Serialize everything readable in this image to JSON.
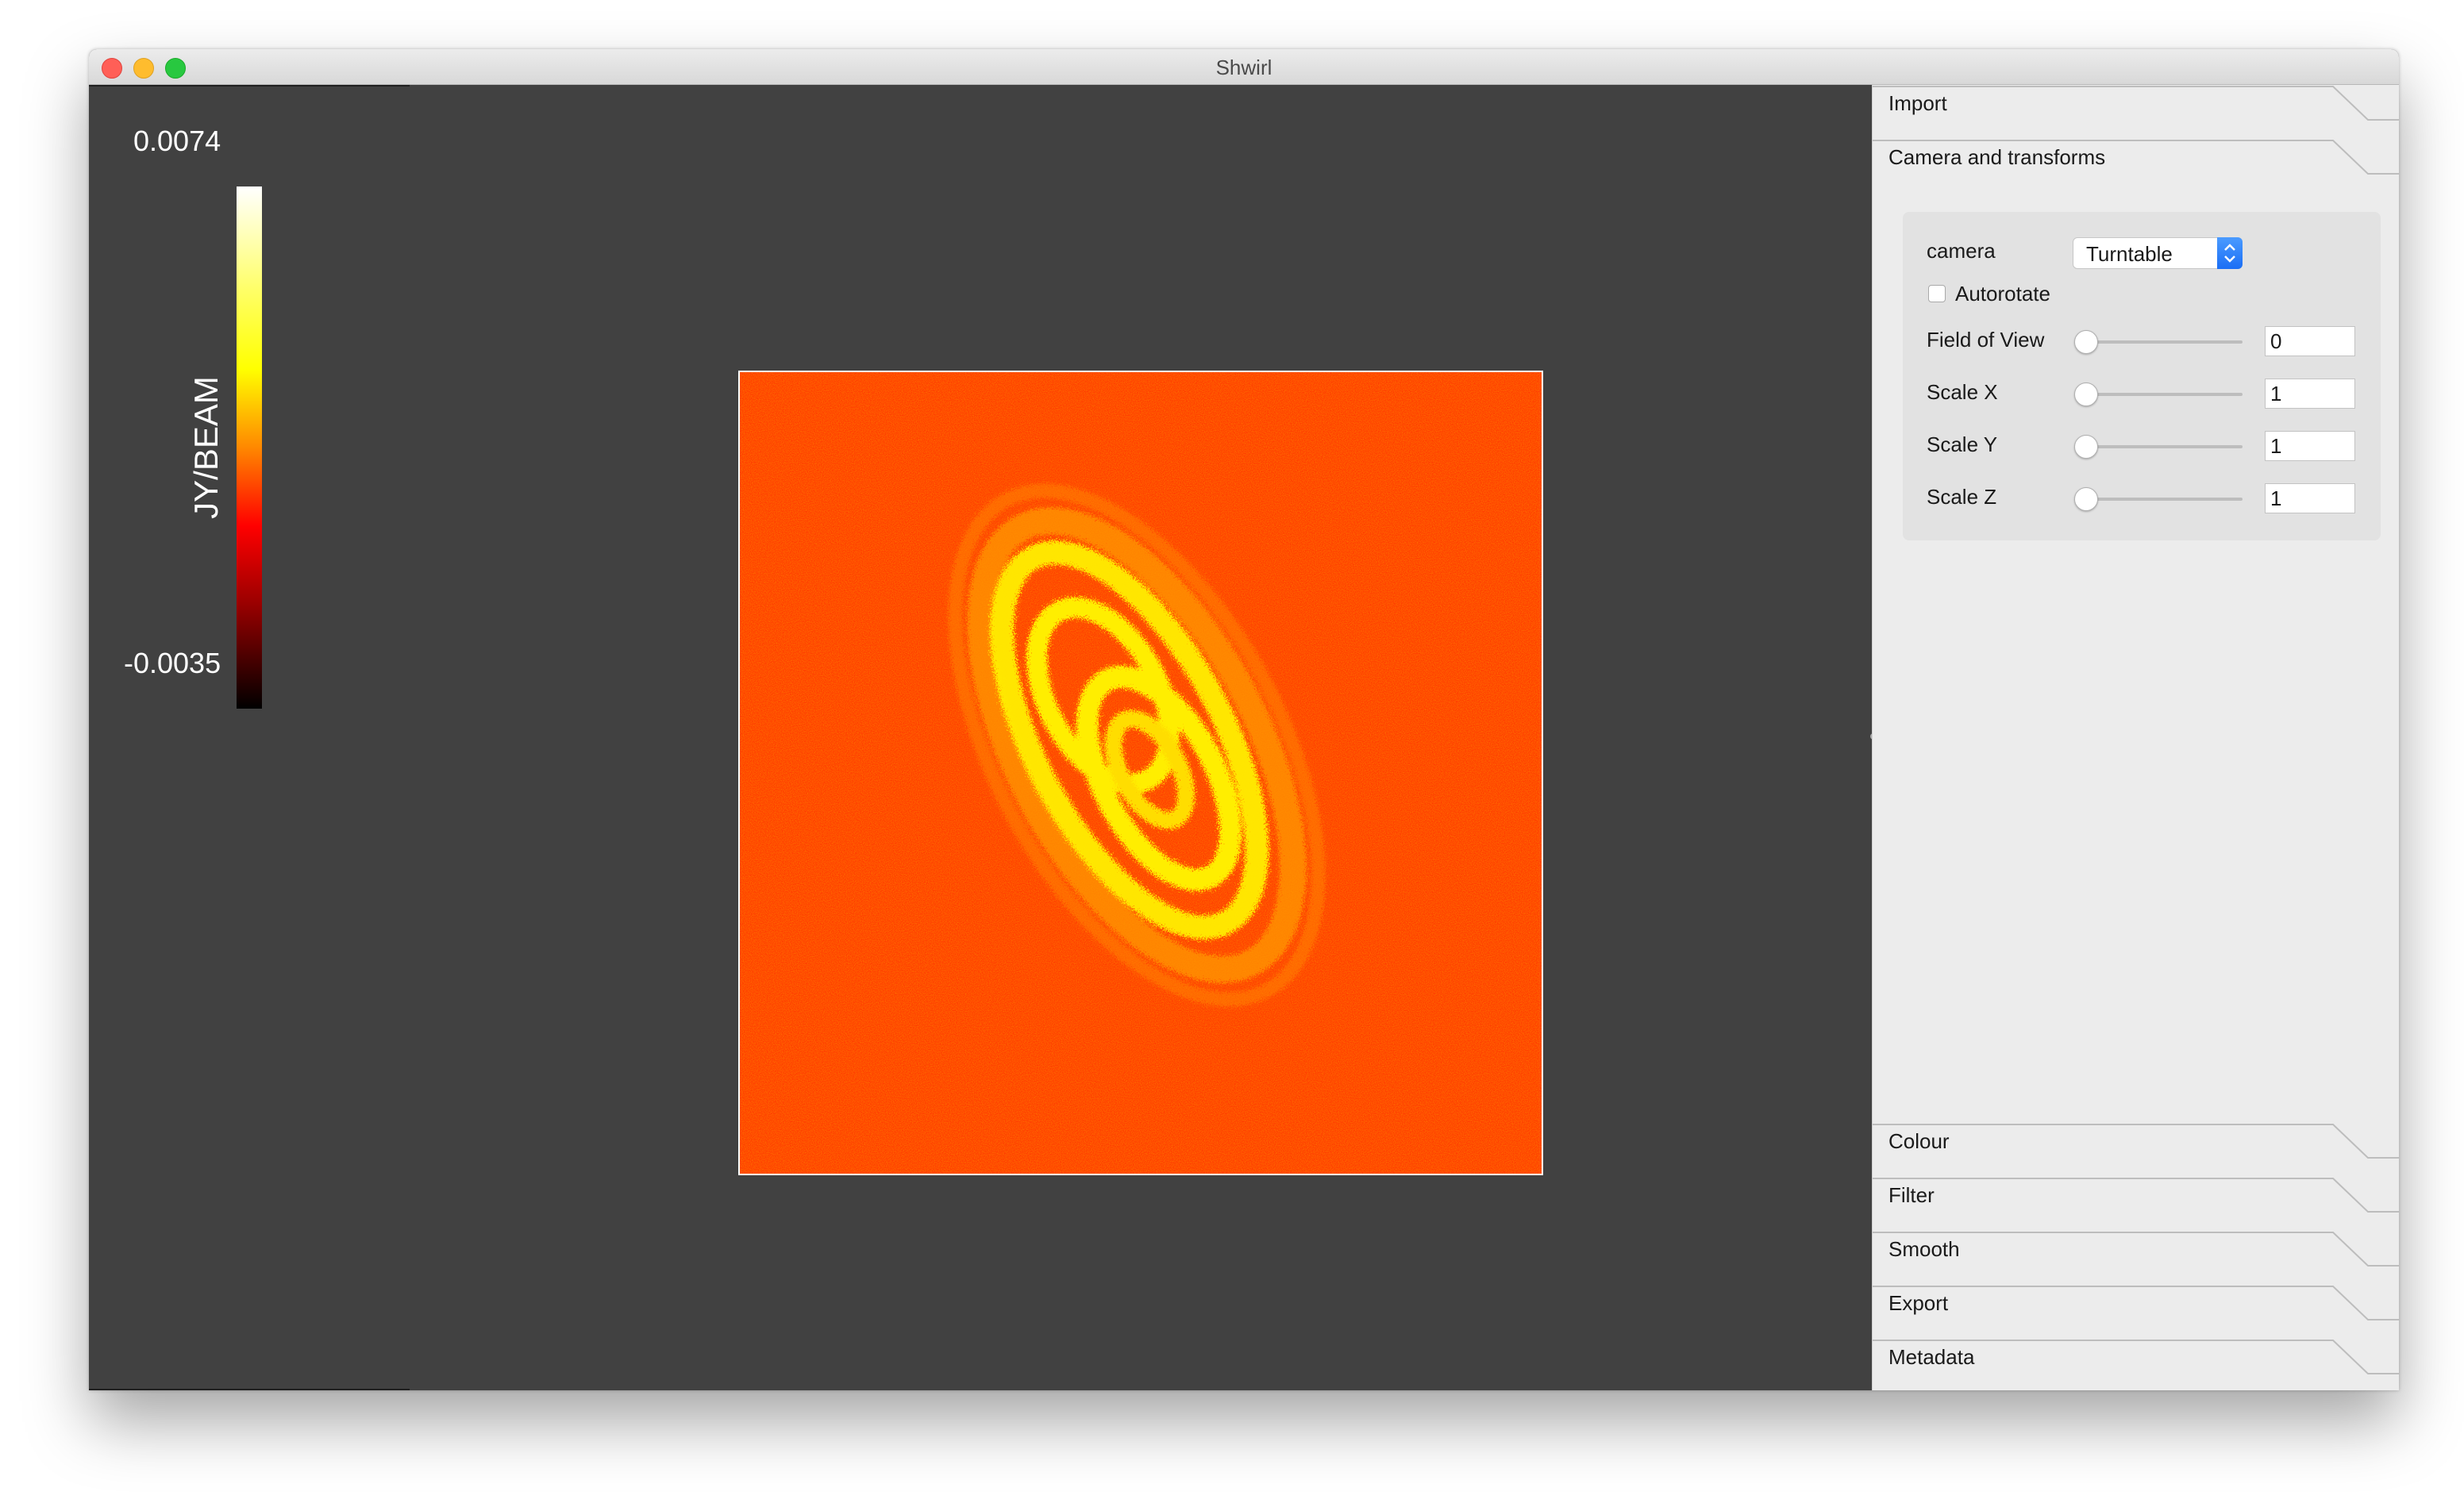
{
  "window": {
    "title": "Shwirl"
  },
  "colorbar": {
    "max_label": "0.0074",
    "min_label": "-0.0035",
    "unit_label": "JY/BEAM",
    "colormap": "hot"
  },
  "sidebar": {
    "tabs_top": [
      {
        "label": "Import"
      },
      {
        "label": "Camera and transforms"
      }
    ],
    "tabs_bottom": [
      {
        "label": "Colour"
      },
      {
        "label": "Filter"
      },
      {
        "label": "Smooth"
      },
      {
        "label": "Export"
      },
      {
        "label": "Metadata"
      }
    ],
    "camera_panel": {
      "camera_label": "camera",
      "camera_value": "Turntable",
      "autorotate_label": "Autorotate",
      "autorotate_checked": false,
      "fov_label": "Field of View",
      "fov_value": "0",
      "scale_x_label": "Scale X",
      "scale_x_value": "1",
      "scale_y_label": "Scale Y",
      "scale_y_value": "1",
      "scale_z_label": "Scale Z",
      "scale_z_value": "1"
    }
  },
  "colors": {
    "viewer_background": "#414141",
    "sidebar_background": "#ececec",
    "accent": "#1a6ef5",
    "image_background": "#ff3a00",
    "galaxy_color": "#ffee00"
  },
  "icons": {
    "close": "close-icon",
    "minimize": "minimize-icon",
    "maximize": "maximize-icon",
    "stepper": "updown-chevron-icon"
  }
}
